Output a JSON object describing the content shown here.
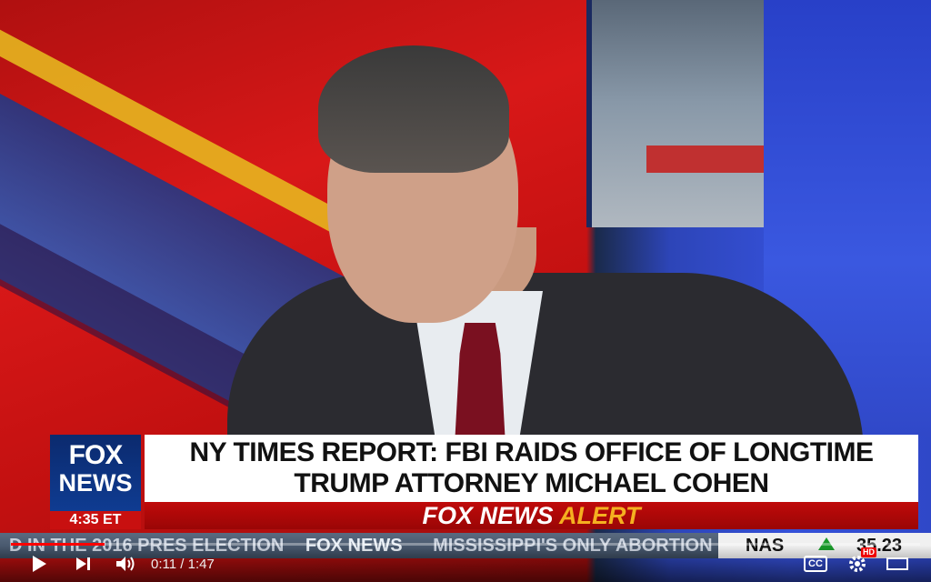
{
  "video": {
    "headline_line1": "NY TIMES REPORT: FBI RAIDS OFFICE OF LONGTIME",
    "headline_line2": "TRUMP ATTORNEY MICHAEL COHEN",
    "network_logo_top": "FOX",
    "network_logo_bottom": "NEWS",
    "time_of_day": "4:35 ET",
    "alert_part1": "FOX NEWS",
    "alert_part2": "ALERT",
    "ticker": {
      "items": [
        "D IN THE 2016 PRES ELECTION",
        "FOX NEWS",
        "MISSISSIPPI'S ONLY ABORTION CLI"
      ],
      "stock_symbol": "NAS",
      "stock_value": "35.23",
      "stock_direction": "up"
    }
  },
  "player": {
    "current_time": "0:11",
    "separator": "/",
    "duration": "1:47",
    "progress_fraction": 0.103,
    "hd_badge": "HD",
    "cc_label": "CC",
    "icons": [
      "play-icon",
      "next-icon",
      "volume-icon",
      "cc-icon",
      "settings-icon",
      "theater-icon"
    ]
  },
  "colors": {
    "progress_played": "#ff0000",
    "alert_red": "#c00a0a",
    "alert_yellow": "#f5b020",
    "fox_blue": "#0b2a6e"
  }
}
